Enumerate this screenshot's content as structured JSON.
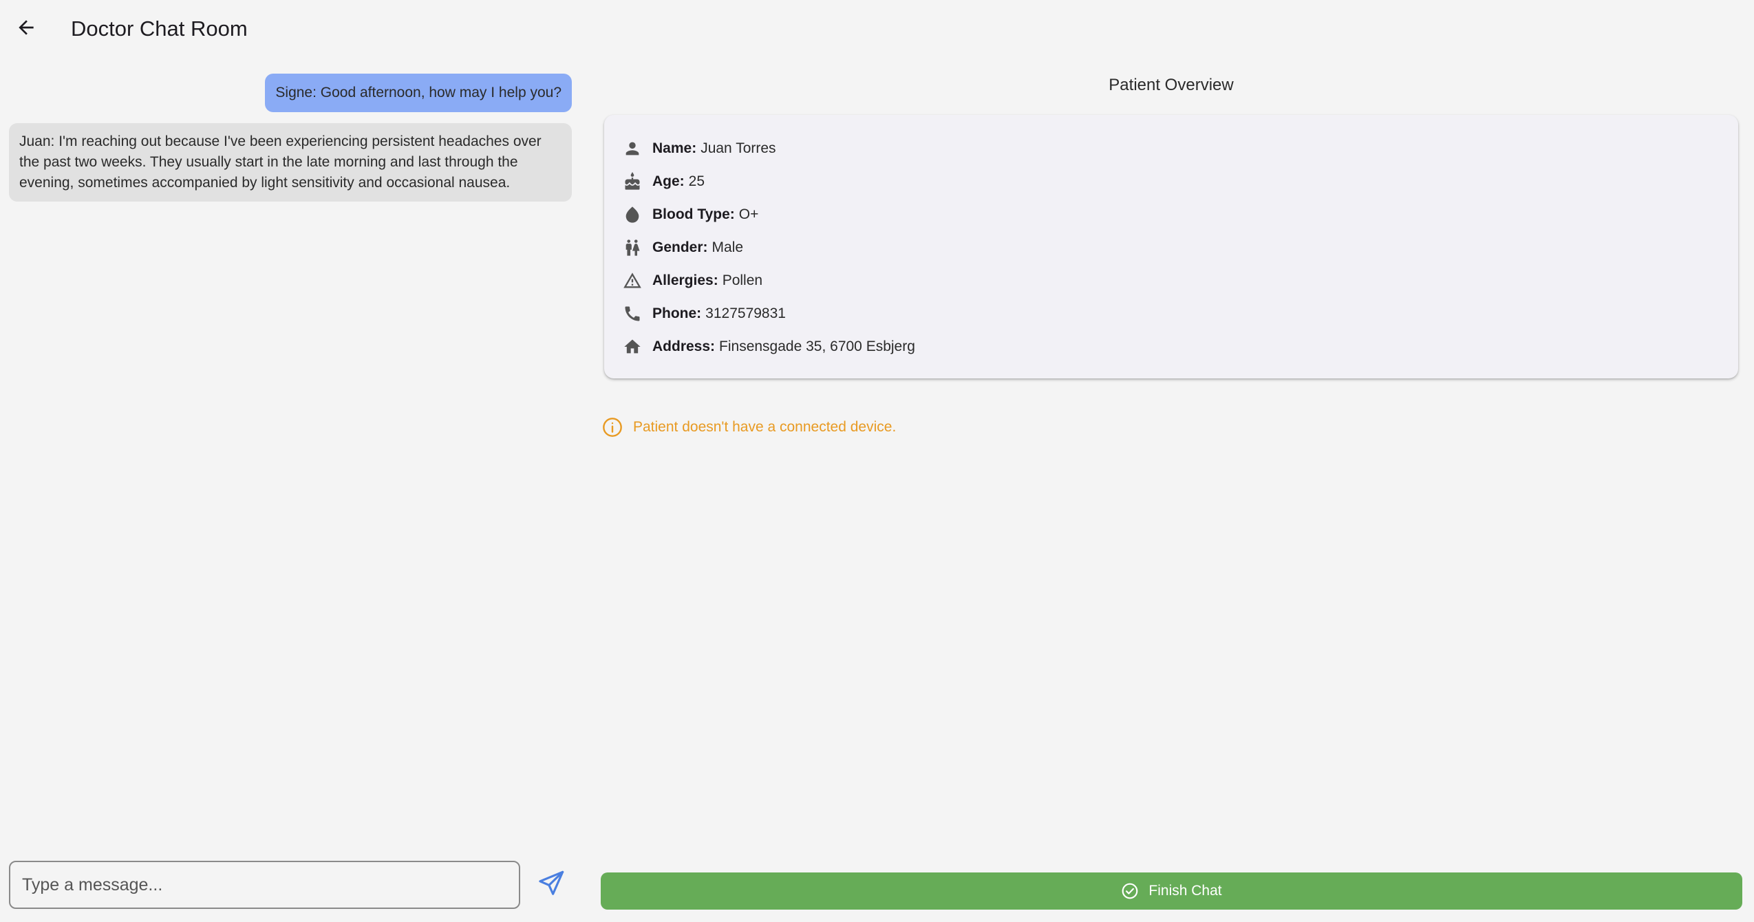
{
  "app_bar": {
    "title": "Doctor Chat Room",
    "back_icon": "arrow-back-icon"
  },
  "chat": {
    "messages": [
      {
        "direction": "outgoing",
        "text": "Signe: Good afternoon, how may I help you?"
      },
      {
        "direction": "incoming",
        "text": "Juan: I'm reaching out because I've been experiencing persistent headaches over the past two weeks. They usually start in the late morning and last through the evening, sometimes accompanied by light sensitivity and occasional nausea."
      }
    ],
    "input": {
      "placeholder": "Type a message...",
      "value": ""
    },
    "send_icon": "send-icon"
  },
  "patient": {
    "section_title": "Patient Overview",
    "fields": [
      {
        "icon": "person-icon",
        "label": "Name:",
        "value": "Juan Torres"
      },
      {
        "icon": "cake-icon",
        "label": "Age:",
        "value": "25"
      },
      {
        "icon": "water-drop-icon",
        "label": "Blood Type:",
        "value": "O+"
      },
      {
        "icon": "wc-icon",
        "label": "Gender:",
        "value": "Male"
      },
      {
        "icon": "warning-icon",
        "label": "Allergies:",
        "value": "Pollen"
      },
      {
        "icon": "phone-icon",
        "label": "Phone:",
        "value": "3127579831"
      },
      {
        "icon": "home-icon",
        "label": "Address:",
        "value": "Finsensgade 35, 6700 Esbjerg"
      }
    ]
  },
  "device_notice": {
    "icon": "info-icon",
    "text": "Patient doesn't have a connected device."
  },
  "finish_button": {
    "icon": "check-circle-icon",
    "label": "Finish Chat"
  },
  "colors": {
    "background": "#f4f4f4",
    "outgoing_bubble": "#8aabf5",
    "incoming_bubble": "#e1e1e1",
    "card": "#f2f1f6",
    "warning_text": "#e89a22",
    "finish_button": "#66ac57",
    "send_icon": "#4a7fe0"
  }
}
